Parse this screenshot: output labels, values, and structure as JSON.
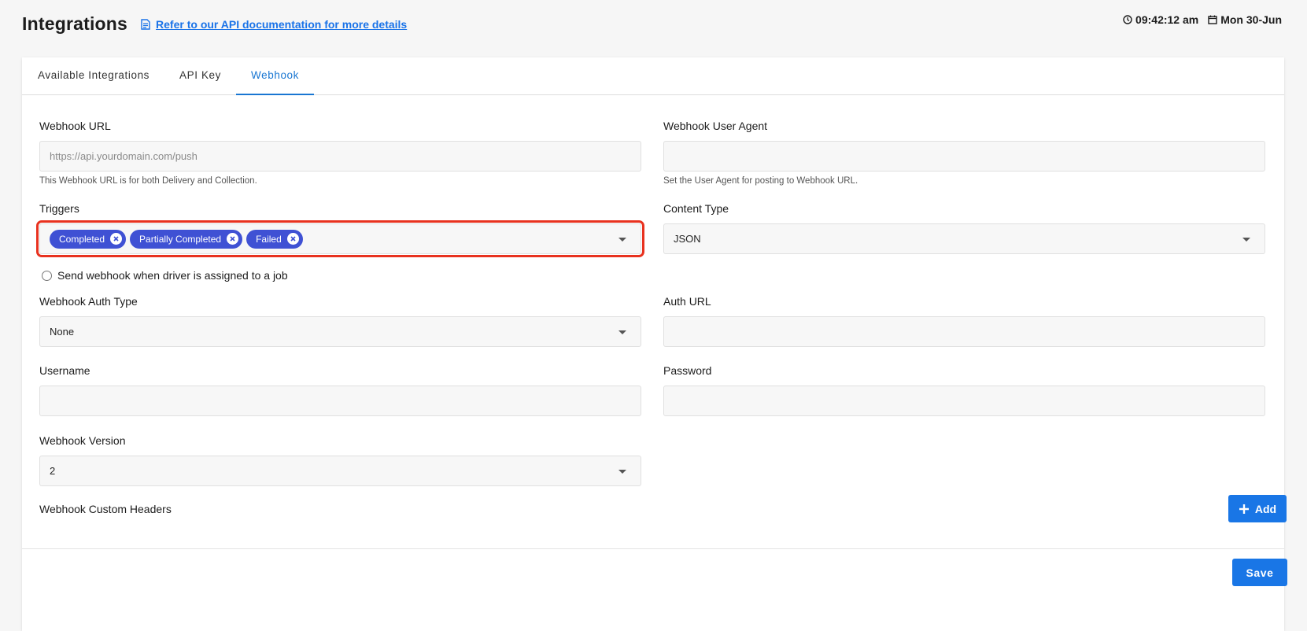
{
  "header": {
    "title": "Integrations",
    "doc_link": "Refer to our API documentation for more details",
    "time": "09:42:12 am",
    "date": "Mon 30-Jun"
  },
  "tabs": [
    {
      "label": "Available Integrations",
      "active": false
    },
    {
      "label": "API Key",
      "active": false
    },
    {
      "label": "Webhook",
      "active": true
    }
  ],
  "form": {
    "webhook_url": {
      "label": "Webhook URL",
      "value": "",
      "placeholder": "https://api.yourdomain.com/push",
      "help": "This Webhook URL is for both Delivery and Collection."
    },
    "user_agent": {
      "label": "Webhook User Agent",
      "value": "",
      "help": "Set the User Agent for posting to Webhook URL."
    },
    "triggers": {
      "label": "Triggers",
      "chips": [
        "Completed",
        "Partially Completed",
        "Failed"
      ]
    },
    "content_type": {
      "label": "Content Type",
      "value": "JSON"
    },
    "driver_assigned": {
      "label": "Send webhook when driver is assigned to a job",
      "checked": false
    },
    "auth_type": {
      "label": "Webhook Auth Type",
      "value": "None"
    },
    "auth_url": {
      "label": "Auth URL",
      "value": ""
    },
    "username": {
      "label": "Username",
      "value": ""
    },
    "password": {
      "label": "Password",
      "value": ""
    },
    "version": {
      "label": "Webhook Version",
      "value": "2"
    },
    "custom_headers": {
      "label": "Webhook Custom Headers",
      "add_label": "Add"
    }
  },
  "footer": {
    "save_label": "Save"
  },
  "colors": {
    "accent": "#1976e6",
    "chip": "#3f51d4",
    "highlight": "#e8321f"
  }
}
